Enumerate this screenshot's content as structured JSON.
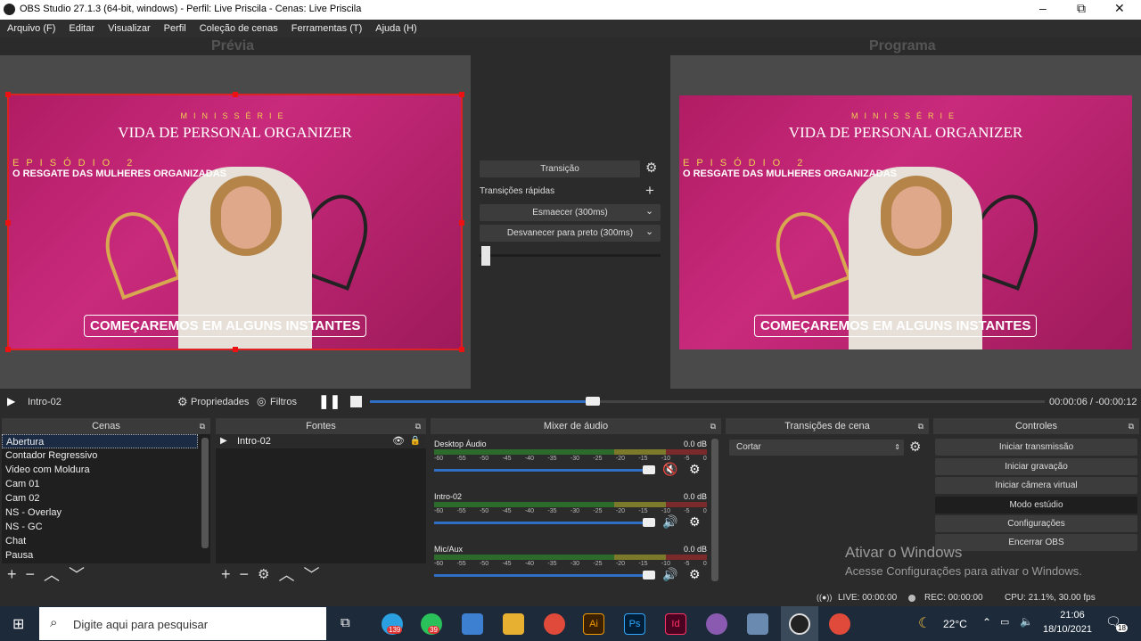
{
  "window": {
    "title": "OBS Studio 27.1.3 (64-bit, windows) - Perfil: Live Priscila - Cenas: Live Priscila",
    "minimize": "–",
    "maximize": "⧉",
    "close": "✕"
  },
  "menu": [
    "Arquivo (F)",
    "Editar",
    "Visualizar",
    "Perfil",
    "Coleção de cenas",
    "Ferramentas (T)",
    "Ajuda (H)"
  ],
  "preview_label": "Prévia",
  "program_label": "Programa",
  "scene_content": {
    "miniserie": "MINISSÉRIE",
    "title": "VIDA DE PERSONAL ORGANIZER",
    "episode": "EPISÓDIO 2",
    "subtitle": "O RESGATE DAS MULHERES ORGANIZADAS",
    "cta": "COMEÇAREMOS EM ALGUNS INSTANTES"
  },
  "transition": {
    "button": "Transição",
    "quick_label": "Transições rápidas",
    "quick1": "Esmaecer (300ms)",
    "quick2": "Desvanecer para preto (300ms)"
  },
  "player": {
    "source": "Intro-02",
    "properties": "Propriedades",
    "filters": "Filtros",
    "time": "00:00:06 / -00:00:12",
    "progress": 0.33
  },
  "docks": {
    "scenes": "Cenas",
    "sources": "Fontes",
    "mixer": "Mixer de áudio",
    "transitions": "Transições de cena",
    "controls": "Controles"
  },
  "scenes": [
    "Abertura",
    "Contador Regressivo",
    "Video com Moldura",
    "Cam 01",
    "Cam 02",
    "NS - Overlay",
    "NS - GC",
    "Chat",
    "Pausa"
  ],
  "sources": [
    "Intro-02"
  ],
  "mixer": [
    {
      "name": "Desktop Áudio",
      "db": "0.0 dB",
      "muted": true
    },
    {
      "name": "Intro-02",
      "db": "0.0 dB",
      "muted": false
    },
    {
      "name": "Mic/Aux",
      "db": "0.0 dB",
      "muted": false
    }
  ],
  "mixer_scale": [
    "-60",
    "-55",
    "-50",
    "-45",
    "-40",
    "-35",
    "-30",
    "-25",
    "-20",
    "-15",
    "-10",
    "-5",
    "0"
  ],
  "scene_transition": "Cortar",
  "controls": [
    "Iniciar transmissão",
    "Iniciar gravação",
    "Iniciar câmera virtual",
    "Modo estúdio",
    "Configurações",
    "Encerrar OBS"
  ],
  "activation": {
    "line1": "Ativar o Windows",
    "line2": "Acesse Configurações para ativar o Windows."
  },
  "status": {
    "live": "LIVE: 00:00:00",
    "rec": "REC: 00:00:00",
    "cpu": "CPU: 21.1%, 30.00 fps"
  },
  "taskbar": {
    "search_placeholder": "Digite aqui para pesquisar",
    "temp": "22°C",
    "time": "21:06",
    "date": "18/10/2021",
    "notif": "18",
    "badge1": "139",
    "badge2": "39"
  }
}
